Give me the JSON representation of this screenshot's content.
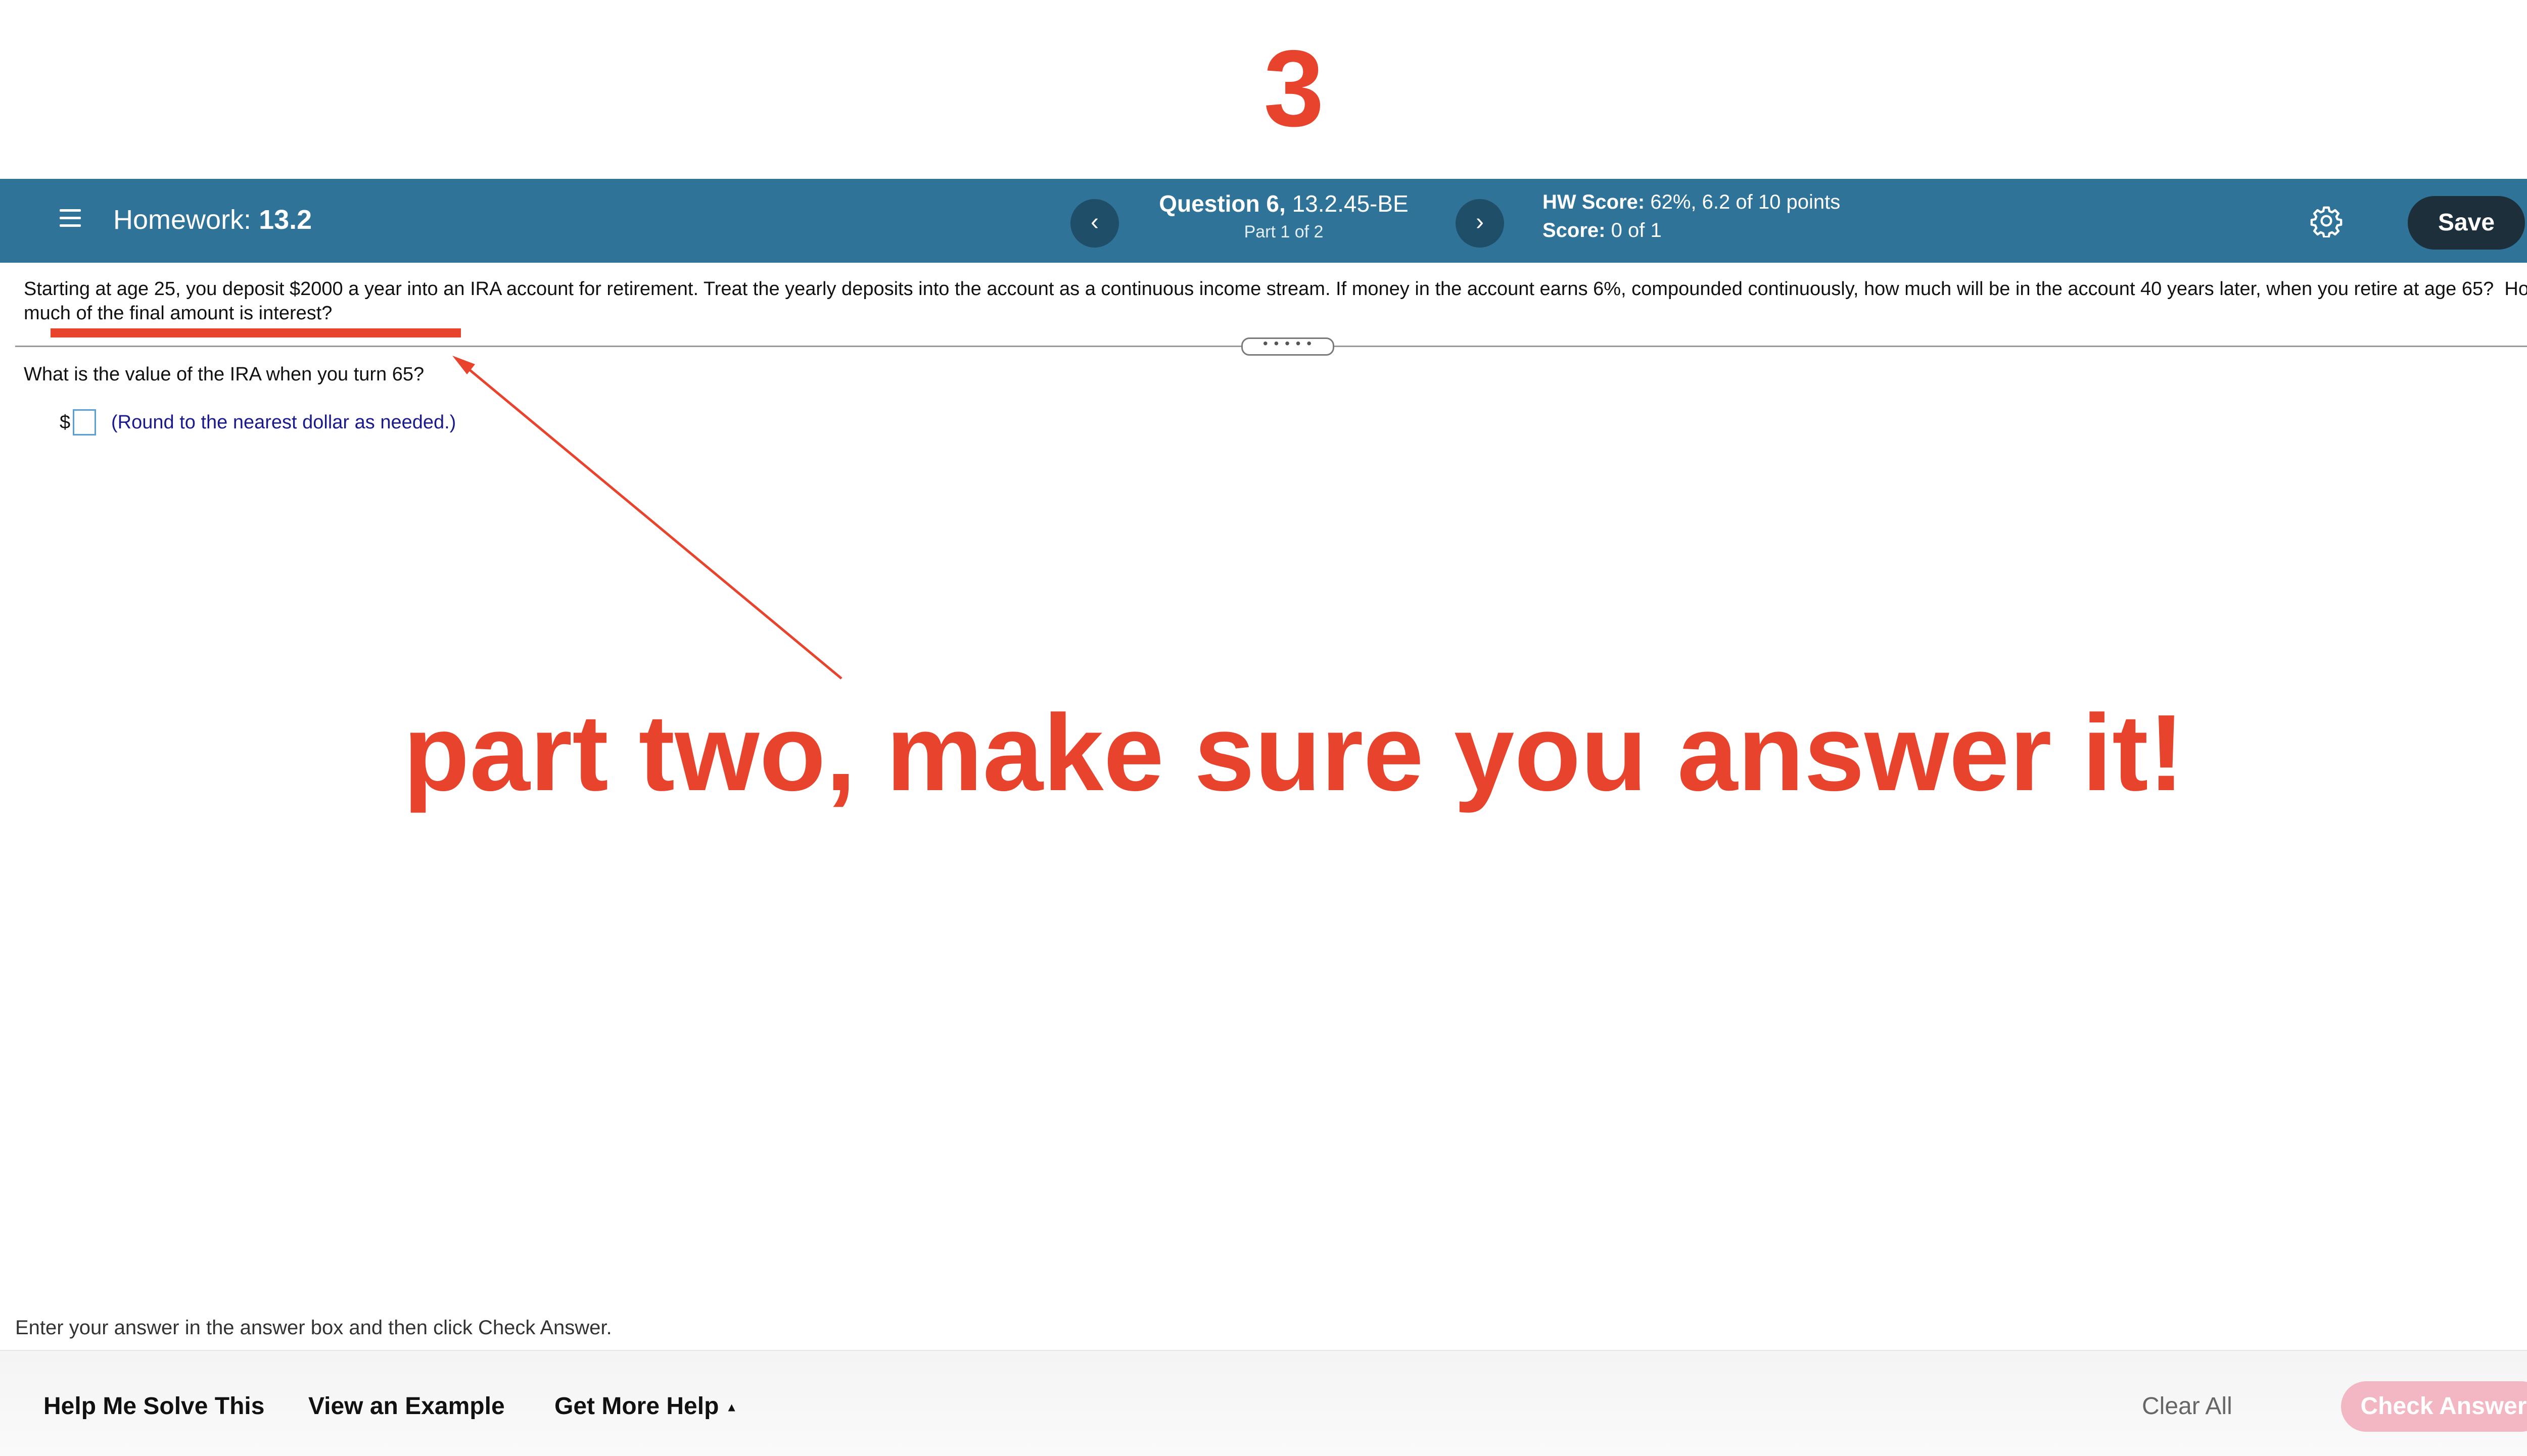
{
  "annotation": {
    "step_number": "3",
    "note": "part two, make sure you answer it!",
    "color": "#e8432d"
  },
  "header": {
    "homework_prefix": "Homework:",
    "homework_name": "13.2",
    "question_label": "Question 6,",
    "question_code": "13.2.45-BE",
    "part": "Part 1 of 2",
    "hw_score_label": "HW Score:",
    "hw_score_value": "62%, 6.2 of 10 points",
    "score_label": "Score:",
    "score_value": "0 of 1",
    "prev_symbol": "‹",
    "next_symbol": "›",
    "save_label": "Save",
    "bar_color": "#2f7498",
    "icons": [
      "hamburger-menu-icon",
      "gear-icon"
    ]
  },
  "question": {
    "text": "Starting at age 25, you deposit $2000 a year into an IRA account for retirement.  Treat the yearly deposits into the account as a continuous income stream.  If money in the account earns 6%, compounded continuously, how much will be in the account 40 years later, when you retire at age 65?",
    "text_part2": "How much of the final amount is interest?",
    "divider_handle": "• • • • •",
    "sub_question": "What is the value of the IRA when you turn 65?",
    "currency": "$",
    "answer_value": "",
    "round_hint": "(Round to the nearest dollar as needed.)"
  },
  "footer": {
    "instruction": "Enter your answer in the answer box and then click Check Answer.",
    "help_me_solve": "Help Me Solve This",
    "view_example": "View an Example",
    "get_more_help": "Get More Help",
    "get_more_help_caret": "▲",
    "clear_all": "Clear All",
    "check_answer": "Check Answer",
    "check_answer_color": "#f2b7c2"
  }
}
